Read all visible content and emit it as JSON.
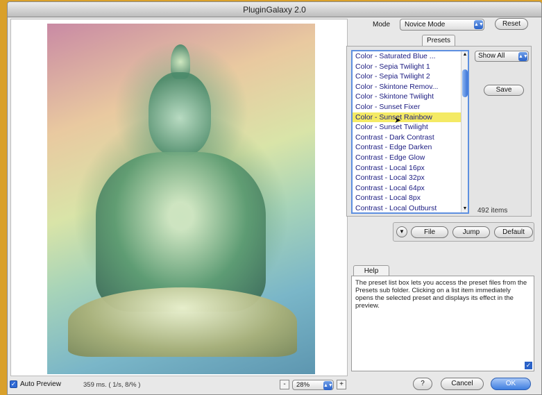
{
  "window": {
    "title": "PluginGalaxy 2.0"
  },
  "mode": {
    "label": "Mode",
    "value": "Novice Mode",
    "reset_label": "Reset"
  },
  "presets": {
    "tab_label": "Presets",
    "items": [
      "Color - Saturated Blue ...",
      "Color - Sepia Twilight 1",
      "Color - Sepia Twilight 2",
      "Color - Skintone Remov...",
      "Color - Skintone Twilight",
      "Color - Sunset Fixer",
      "Color - Sunset Rainbow",
      "Color - Sunset Twilight",
      "Contrast - Dark Contrast",
      "Contrast - Edge Darken",
      "Contrast - Edge Glow",
      "Contrast - Local 16px",
      "Contrast - Local 32px",
      "Contrast - Local 64px",
      "Contrast - Local 8px",
      "Contrast - Local Outburst"
    ],
    "selected_index": 6,
    "show_value": "Show All",
    "save_label": "Save",
    "items_count": "492 items",
    "file_label": "File",
    "jump_label": "Jump",
    "default_label": "Default"
  },
  "help": {
    "tab_label": "Help",
    "text": "The preset list box lets you access the preset files from the Presets sub folder. Clicking on a list item immediately opens the selected preset and displays its effect in the preview."
  },
  "footer": {
    "auto_preview_label": "Auto Preview",
    "timing": "359 ms. ( 1/s, 8/% )",
    "zoom_value": "28%",
    "help_label": "?",
    "cancel_label": "Cancel",
    "ok_label": "OK"
  },
  "colors": {
    "selection": "#f4ea64",
    "accent": "#3e7ee0"
  }
}
